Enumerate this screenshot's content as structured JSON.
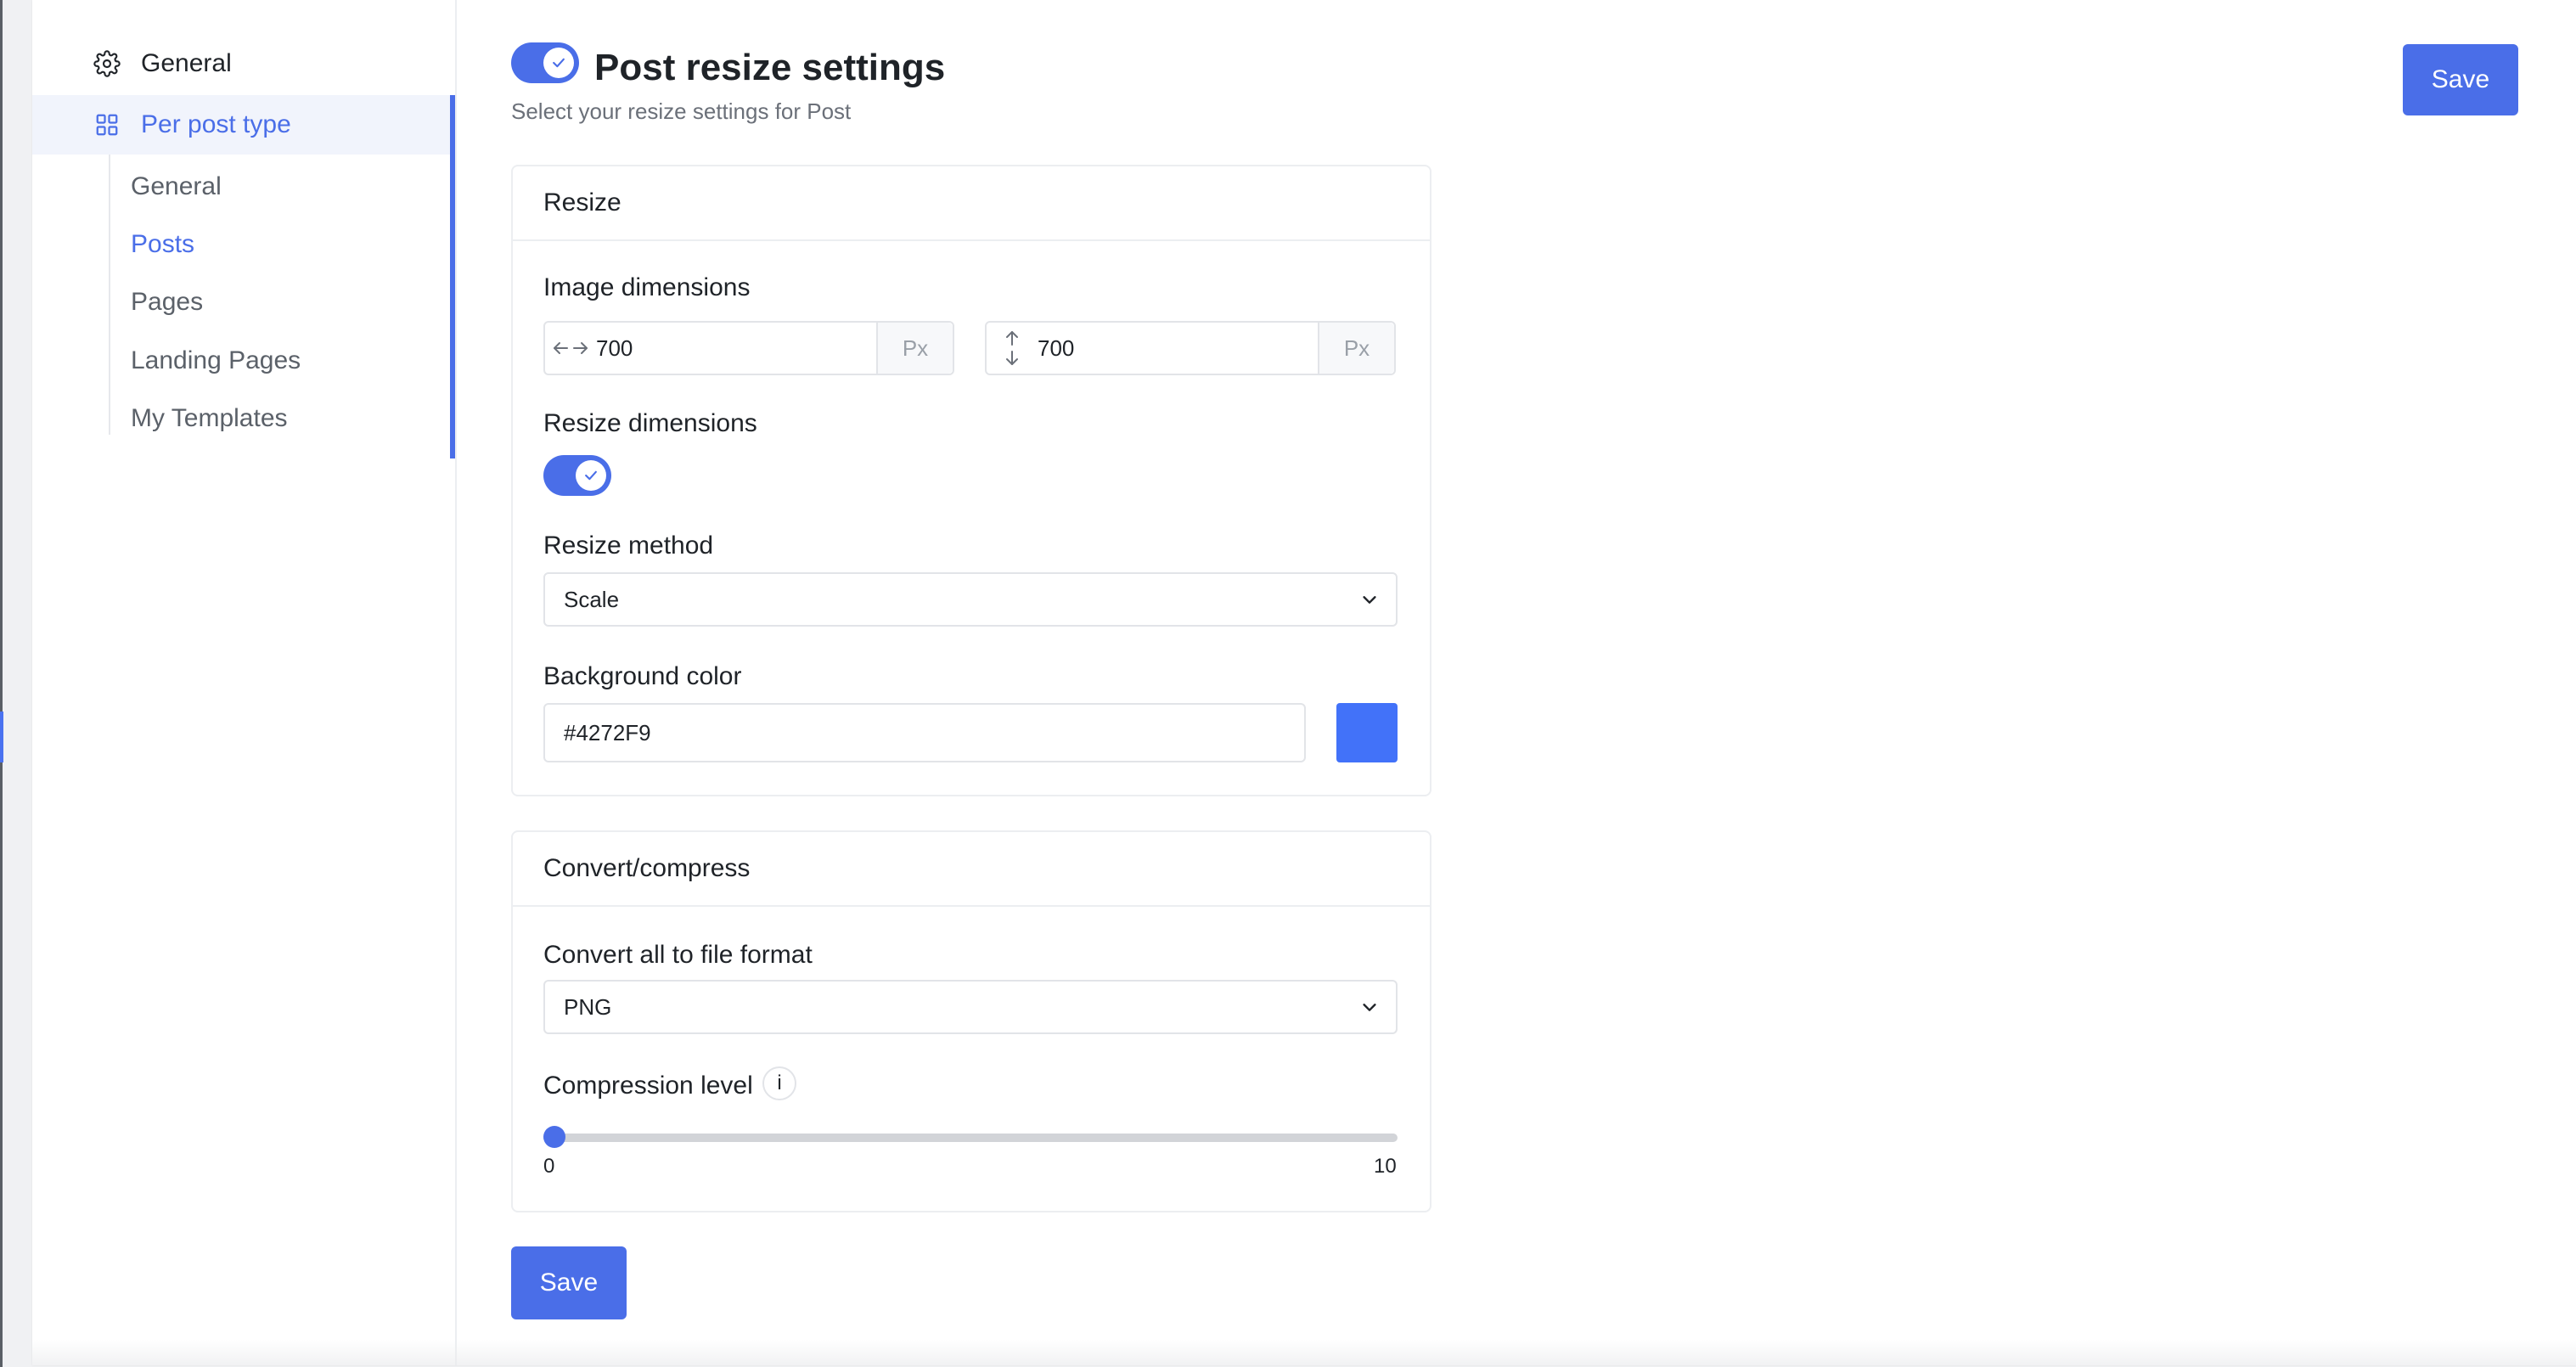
{
  "sidebar": {
    "general_label": "General",
    "per_post_type_label": "Per post type",
    "sub_items": [
      "General",
      "Posts",
      "Pages",
      "Landing Pages",
      "My Templates"
    ],
    "active_sub_item": "Posts"
  },
  "header": {
    "title": "Post resize settings",
    "subtitle": "Select your resize settings for Post",
    "enabled": true,
    "save_label": "Save"
  },
  "resize_card": {
    "title": "Resize",
    "image_dimensions_label": "Image dimensions",
    "width_value": "700",
    "height_value": "700",
    "unit": "Px",
    "resize_dimensions_label": "Resize dimensions",
    "resize_dimensions_enabled": true,
    "resize_method_label": "Resize method",
    "resize_method_value": "Scale",
    "background_color_label": "Background color",
    "background_color_value": "#4272F9"
  },
  "convert_card": {
    "title": "Convert/compress",
    "file_format_label": "Convert all to file format",
    "file_format_value": "PNG",
    "compression_label": "Compression level",
    "info_icon_glyph": "i",
    "compression_value": 0,
    "compression_min": "0",
    "compression_max": "10"
  },
  "footer": {
    "save_label": "Save"
  },
  "colors": {
    "accent": "#4a6ee8"
  }
}
